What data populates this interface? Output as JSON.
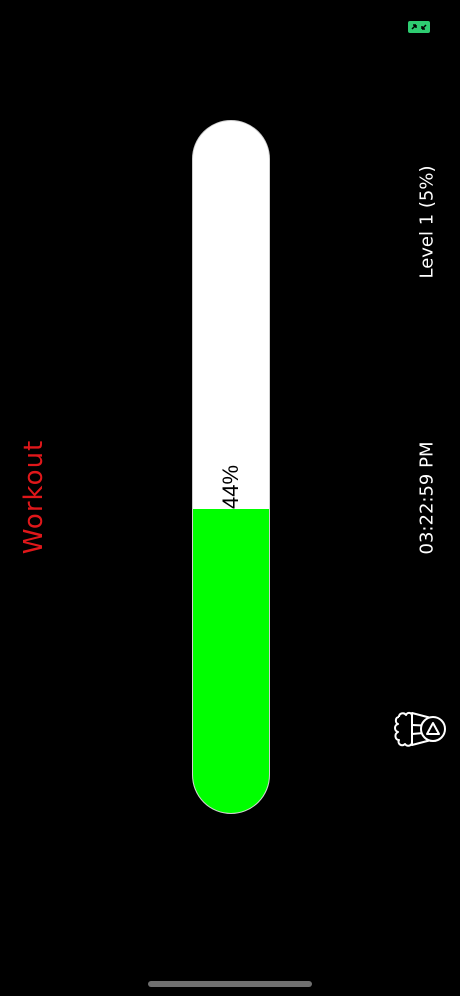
{
  "title": "Workout",
  "progress": {
    "percent": 44,
    "label": "44%",
    "fill_color": "#00ff00",
    "track_color": "#ffffff"
  },
  "level": {
    "label": "Level 1 (5%)"
  },
  "clock": {
    "time": "03:22:59 PM"
  },
  "colors": {
    "title": "#e0171a",
    "text": "#ffffff",
    "background": "#000000",
    "status_icon": "#2ecc71"
  },
  "icons": {
    "status": "fullscreen-toggle-icon",
    "popcorn": "popcorn-play-icon"
  }
}
